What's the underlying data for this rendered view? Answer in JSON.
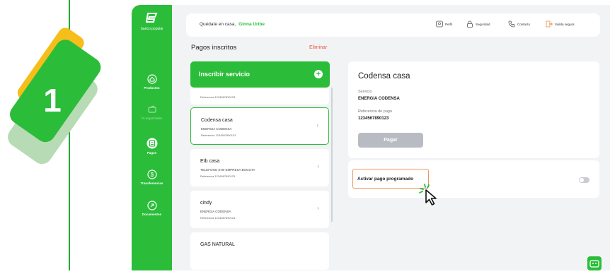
{
  "step": {
    "number": "1"
  },
  "colors": {
    "brand_green": "#2bbd3a",
    "accent_orange": "#f0955a",
    "delete_red": "#e25b3a",
    "badge_yellow": "#f6be1a",
    "badge_light": "#b7dbb4"
  },
  "sidebar": {
    "logo_text": "banco popular",
    "items": [
      {
        "label": "Productos",
        "icon": "home-icon",
        "active": true
      },
      {
        "label": "Tu organizador",
        "icon": "wallet-icon",
        "active": false
      },
      {
        "label": "Pagos",
        "icon": "payments-icon",
        "active": true
      },
      {
        "label": "Transferencias",
        "icon": "dollar-circle-icon",
        "active": true
      },
      {
        "label": "Documentos",
        "icon": "document-icon",
        "active": true
      }
    ]
  },
  "header": {
    "greeting": "Quédate en casa,",
    "user_name": "Ginna Uribe",
    "links": {
      "profile": "Perfil",
      "security": "Seguridad",
      "contact": "Contacto",
      "logout": "Salida segura"
    }
  },
  "services": {
    "title": "Pagos inscritos",
    "delete_label": "Eliminar",
    "subscribe_label": "Inscribir servicio",
    "partial_reference": "Referencia 1234567890123",
    "items": [
      {
        "name": "Codensa casa",
        "company": "ENERGIA CODENSA",
        "reference": "Referencia 1234567890123",
        "selected": true
      },
      {
        "name": "Etb casa",
        "company": "TELEFONO ETB EMPRESA BOGOTA",
        "reference": "Referencia 1234567890123",
        "selected": false
      },
      {
        "name": "cindy",
        "company": "ENERGIA CODENSA",
        "reference": "Referencia 1234567890123",
        "selected": false
      },
      {
        "name": "GAS NATURAL",
        "company": "",
        "reference": "",
        "selected": false
      }
    ]
  },
  "detail": {
    "title": "Codensa casa",
    "service_label": "Servicio",
    "service_value": "ENERGIA CODENSA",
    "reference_label": "Referencia de pago",
    "reference_value": "1234567890123",
    "pay_label": "Pagar"
  },
  "schedule": {
    "label": "Activar pago programado",
    "enabled": false
  }
}
